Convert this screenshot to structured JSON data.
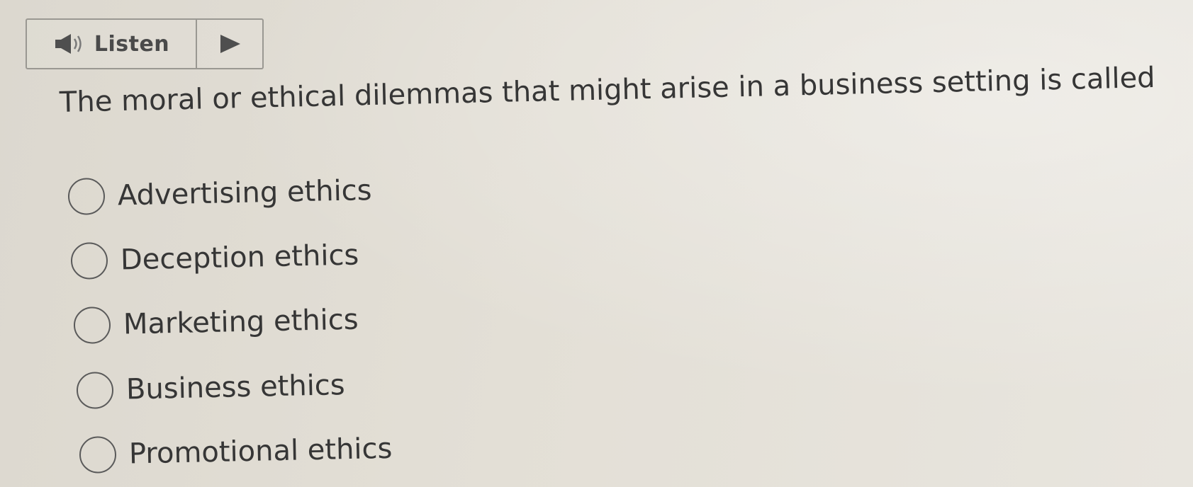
{
  "toolbar": {
    "listen_label": "Listen",
    "speaker_icon": "speaker-icon",
    "play_icon": "play-icon"
  },
  "question": {
    "text": "The moral or ethical dilemmas that might arise in a business setting is called"
  },
  "options": [
    {
      "label": "Advertising ethics",
      "selected": false
    },
    {
      "label": "Deception ethics",
      "selected": false
    },
    {
      "label": "Marketing ethics",
      "selected": false
    },
    {
      "label": "Business ethics",
      "selected": false
    },
    {
      "label": "Promotional ethics",
      "selected": false
    }
  ],
  "colors": {
    "text": "#363636",
    "border": "#9a9892",
    "icon": "#4f4f4f"
  }
}
